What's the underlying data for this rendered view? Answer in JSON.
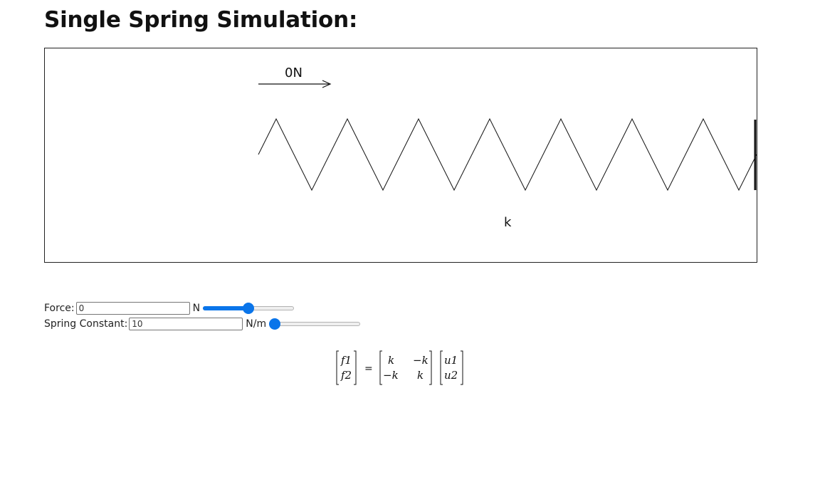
{
  "page": {
    "title": "Single Spring Simulation:"
  },
  "simulation": {
    "force_readout": "0N",
    "spring_label": "k"
  },
  "controls": {
    "force": {
      "label": "Force:",
      "value": "0",
      "unit": "N",
      "slider_fraction": 0.5
    },
    "spring_constant": {
      "label": "Spring Constant:",
      "value": "10",
      "unit": "N/m",
      "slider_fraction": 0.0
    }
  },
  "equation": {
    "lhs": [
      "f1",
      "f2"
    ],
    "equals": "=",
    "matrix": [
      [
        "k",
        "−k"
      ],
      [
        "−k",
        "k"
      ]
    ],
    "rhs": [
      "u1",
      "u2"
    ]
  },
  "colors": {
    "accent": "#0a75ea",
    "ink": "#111111"
  }
}
